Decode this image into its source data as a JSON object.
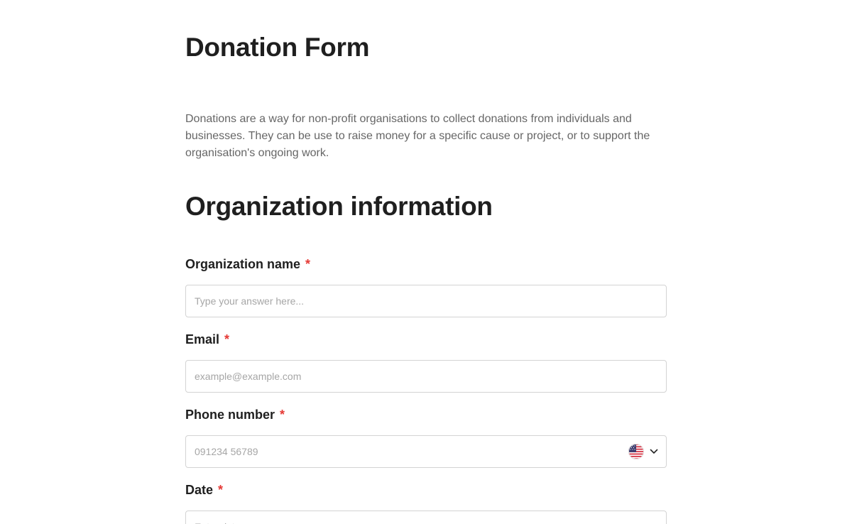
{
  "form": {
    "title": "Donation Form",
    "description": "Donations are a way for non-profit organisations to collect donations from individuals and businesses. They can be use to raise money for a specific cause or project, or to support the organisation's ongoing work."
  },
  "section": {
    "title": "Organization information"
  },
  "fields": {
    "organization_name": {
      "label": "Organization name",
      "required_mark": "*",
      "placeholder": "Type your answer here...",
      "value": ""
    },
    "email": {
      "label": "Email",
      "required_mark": "*",
      "placeholder": "example@example.com",
      "value": ""
    },
    "phone": {
      "label": "Phone number",
      "required_mark": "*",
      "placeholder": "091234 56789",
      "value": "",
      "country_icon": "us-flag-icon",
      "dropdown_icon": "chevron-down-icon"
    },
    "date": {
      "label": "Date",
      "required_mark": "*",
      "placeholder": "Enter date",
      "value": ""
    }
  },
  "colors": {
    "heading": "#1f1f1f",
    "body_text": "#666666",
    "required": "#e53935",
    "input_border": "#d3d3d3",
    "placeholder": "#a6a6a6"
  }
}
